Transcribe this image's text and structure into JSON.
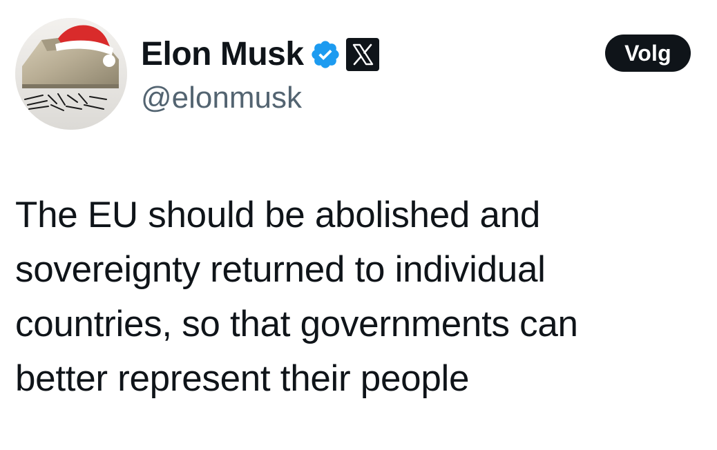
{
  "tweet": {
    "author": {
      "display_name": "Elon Musk",
      "handle": "@elonmusk",
      "avatar_icon": "avatar-santa-hat-icon",
      "verified_icon": "verified-badge-icon",
      "affiliate_icon": "x-logo-icon"
    },
    "follow_label": "Volg",
    "text_lines": [
      "The EU should be abolished and",
      "sovereignty returned to individual",
      "countries, so that governments can",
      "better represent their people"
    ]
  },
  "colors": {
    "background": "#ffffff",
    "text": "#0f1419",
    "handle": "#536471",
    "verified": "#1d9bf0",
    "button_bg": "#0f1419",
    "button_text": "#ffffff"
  }
}
